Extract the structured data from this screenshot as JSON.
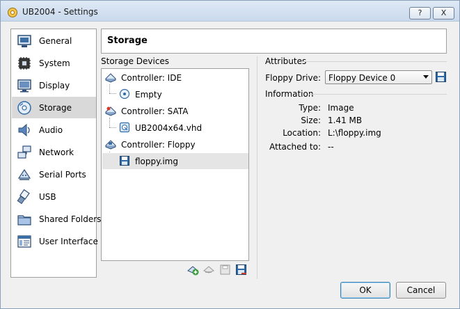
{
  "window": {
    "title": "UB2004 - Settings",
    "help_label": "?",
    "close_label": "X"
  },
  "sidebar": {
    "items": [
      {
        "label": "General",
        "icon": "general-icon"
      },
      {
        "label": "System",
        "icon": "system-chip-icon"
      },
      {
        "label": "Display",
        "icon": "display-monitor-icon"
      },
      {
        "label": "Storage",
        "icon": "storage-disc-icon",
        "selected": true
      },
      {
        "label": "Audio",
        "icon": "speaker-icon"
      },
      {
        "label": "Network",
        "icon": "network-icon"
      },
      {
        "label": "Serial Ports",
        "icon": "serial-port-icon"
      },
      {
        "label": "USB",
        "icon": "usb-icon"
      },
      {
        "label": "Shared Folders",
        "icon": "folder-icon"
      },
      {
        "label": "User Interface",
        "icon": "user-interface-icon"
      }
    ]
  },
  "page": {
    "title": "Storage"
  },
  "storage_devices": {
    "label": "Storage Devices",
    "tree": [
      {
        "label": "Controller: IDE",
        "kind": "controller",
        "icon": "ide-controller-icon"
      },
      {
        "label": "Empty",
        "kind": "attachment",
        "icon": "optical-disc-icon"
      },
      {
        "label": "Controller: SATA",
        "kind": "controller",
        "icon": "sata-controller-icon"
      },
      {
        "label": "UB2004x64.vhd",
        "kind": "attachment",
        "icon": "hard-disk-icon"
      },
      {
        "label": "Controller: Floppy",
        "kind": "controller",
        "icon": "floppy-controller-icon"
      },
      {
        "label": "floppy.img",
        "kind": "attachment",
        "icon": "floppy-disk-icon",
        "selected": true
      }
    ],
    "toolbar": [
      "add-attachment-icon",
      "remove-attachment-icon",
      "add-disk-icon",
      "floppy-action-icon"
    ]
  },
  "attributes": {
    "label": "Attributes",
    "floppy_drive_label": "Floppy Drive:",
    "floppy_drive_value": "Floppy Device 0"
  },
  "information": {
    "label": "Information",
    "type_label": "Type:",
    "type_value": "Image",
    "size_label": "Size:",
    "size_value": "1.41 MB",
    "location_label": "Location:",
    "location_value": "L:\\floppy.img",
    "attached_label": "Attached to:",
    "attached_value": "--"
  },
  "buttons": {
    "ok": "OK",
    "cancel": "Cancel"
  }
}
